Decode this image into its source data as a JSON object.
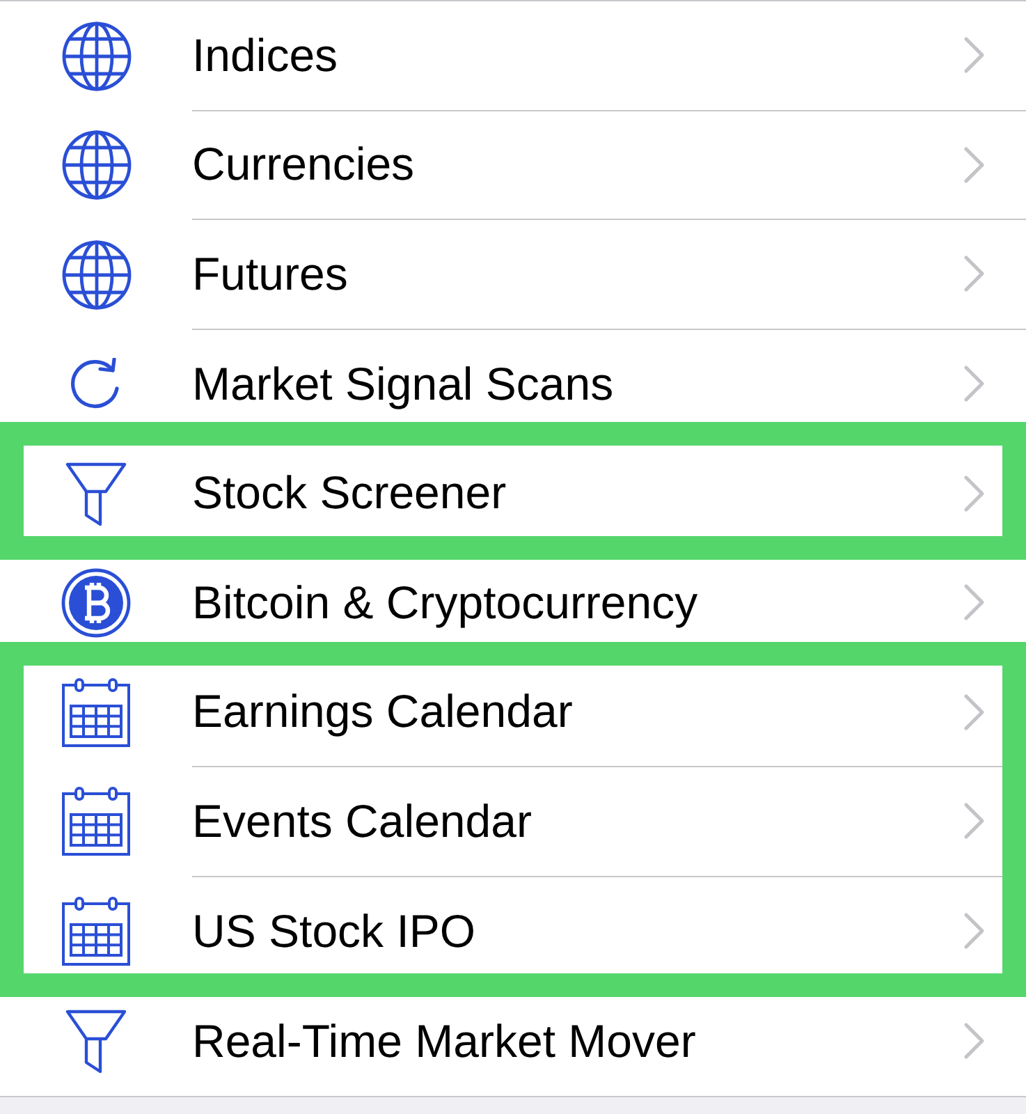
{
  "rows": [
    {
      "label": "Indices",
      "kind": "globe",
      "highlighted": false
    },
    {
      "label": "Currencies",
      "kind": "globe",
      "highlighted": false
    },
    {
      "label": "Futures",
      "kind": "globe",
      "highlighted": false
    },
    {
      "label": "Market Signal Scans",
      "kind": "refresh",
      "highlighted": false
    },
    {
      "label": "Stock Screener",
      "kind": "funnel",
      "highlighted": true
    },
    {
      "label": "Bitcoin & Cryptocurrency",
      "kind": "bitcoin",
      "highlighted": false
    },
    {
      "label": "Earnings Calendar",
      "kind": "calendar",
      "highlighted": true
    },
    {
      "label": "Events Calendar",
      "kind": "calendar",
      "highlighted": true
    },
    {
      "label": "US Stock IPO",
      "kind": "calendar",
      "highlighted": true
    },
    {
      "label": "Real-Time Market Mover",
      "kind": "funnel",
      "highlighted": false
    }
  ]
}
